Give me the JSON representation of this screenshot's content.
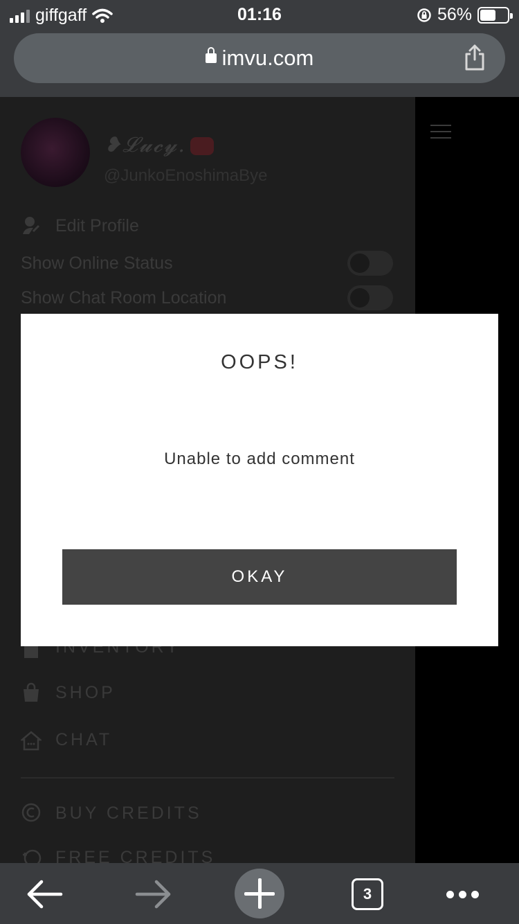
{
  "status_bar": {
    "carrier": "giffgaff",
    "time": "01:16",
    "battery": "56%"
  },
  "browser": {
    "url": "imvu.com"
  },
  "profile": {
    "display_name": "❥𝓛𝓾𝓬𝔂.",
    "handle": "@JunkoEnoshimaBye"
  },
  "menu": {
    "edit_profile": "Edit Profile",
    "show_online_status": "Show Online Status",
    "show_chat_room_location": "Show Chat Room Location",
    "inventory": "INVENTORY",
    "shop": "SHOP",
    "chat": "CHAT",
    "buy_credits": "BUY CREDITS",
    "free_credits": "FREE CREDITS"
  },
  "dialog": {
    "title": "OOPS!",
    "message": "Unable to add comment",
    "okay_label": "OKAY"
  },
  "toolbar": {
    "tab_count": "3"
  },
  "colors": {
    "chrome": "#3a3c3f",
    "url_field": "#5c6165",
    "okay_button": "#444444"
  }
}
